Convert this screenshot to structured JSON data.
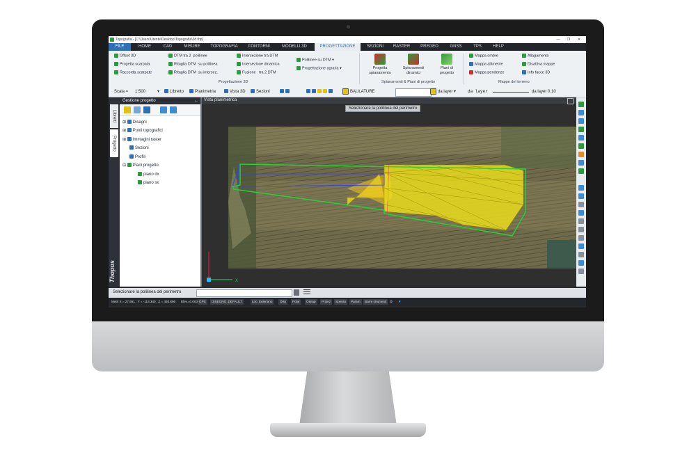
{
  "window": {
    "title": "Topografia - [C:\\Users\\Utente\\Desktop\\Topografia\\3d.thp]",
    "controls": [
      "—",
      "❐",
      "✕"
    ]
  },
  "menu": {
    "file": "FILE",
    "tabs": [
      "HOME",
      "CAD",
      "MISURE",
      "TOPOGRAFIA",
      "CONTORNI",
      "MODELLI 3D",
      "PROGETTAZIONE",
      "SEZIONI",
      "RASTER",
      "PREGEO",
      "GNSS",
      "TPS",
      "HELP"
    ],
    "active": "PROGETTAZIONE"
  },
  "ribbon": {
    "col1": [
      "Offset 3D",
      "Progetta scarpata",
      "Raccorda scarpate"
    ],
    "col2": [
      {
        "a": "DTM tra 2",
        "b": "polilinee"
      },
      {
        "a": "Ritaglia DTM",
        "b": "su polilinea"
      },
      {
        "a": "Ritaglia DTM",
        "b": "su intersez."
      }
    ],
    "col3": [
      "Intersezione tra DTM",
      "Intersezione dinamica",
      "Fusione"
    ],
    "col3_extra": "tra 2 DTM",
    "col4": [
      "Polilinee  su DTM",
      "Progettazione agraria"
    ],
    "group1_label": "Progettazione 3D",
    "big_buttons": [
      {
        "line1": "Progetta",
        "line2": "spianamento"
      },
      {
        "line1": "Spianamenti",
        "line2": "dinamici"
      },
      {
        "line1": "Piani di",
        "line2": "progetto"
      }
    ],
    "group2_label": "Spianamenti & Piani di progetto",
    "col5": [
      "Mappa ombre",
      "Mappa altimetrie",
      "Mappa pendenze"
    ],
    "col6": [
      "Allagamento",
      "Disattiva mappe",
      "Info facce 3D"
    ],
    "group3_label": "Mappe del terreno"
  },
  "toolbar": {
    "scale_label": "Scala =",
    "scale_value": "1:500",
    "libretto": "Libretto",
    "planimetria": "Planimetria",
    "vista3d": "Vista 3D",
    "sezioni": "Sezioni",
    "layer": "BAULATURE",
    "color_mode": "da layer",
    "linetype": "da layer",
    "lineweight": "da layer 0.10"
  },
  "sidebar": {
    "vtabs": [
      "Libretti",
      "Progetto"
    ],
    "brand": "Thopos",
    "panel_title": "Gestione progetto",
    "tree": [
      "Disegni",
      "Punti topografici",
      "Immagini raster",
      "Sezioni",
      "Profili",
      "Piani progetto"
    ],
    "children": [
      "piano dx",
      "piano sx"
    ]
  },
  "view": {
    "title": "Vista planimetrica",
    "prompt": "Selezionare la polilinea del perimetro",
    "axis_x": "X",
    "colors": {
      "perimeter": "#1fd43a",
      "surface": "#f0e21a",
      "polyline": "#3a3cff"
    }
  },
  "command": {
    "text": "Selezionare la polilinea del perimetro"
  },
  "status": {
    "coords": "Metri  X = 27.951 ; Y = -113.340 ; Z = 493.896",
    "elev": "Elev.=0.000",
    "gps": "GPS",
    "drawing": "DISEGNO_DEFAULT",
    "items": [
      "Loc. Euleriano",
      "Orto",
      "Polar",
      "Osnap",
      "Proiez",
      "Spesso",
      "Param",
      "Barre strumenti"
    ]
  }
}
